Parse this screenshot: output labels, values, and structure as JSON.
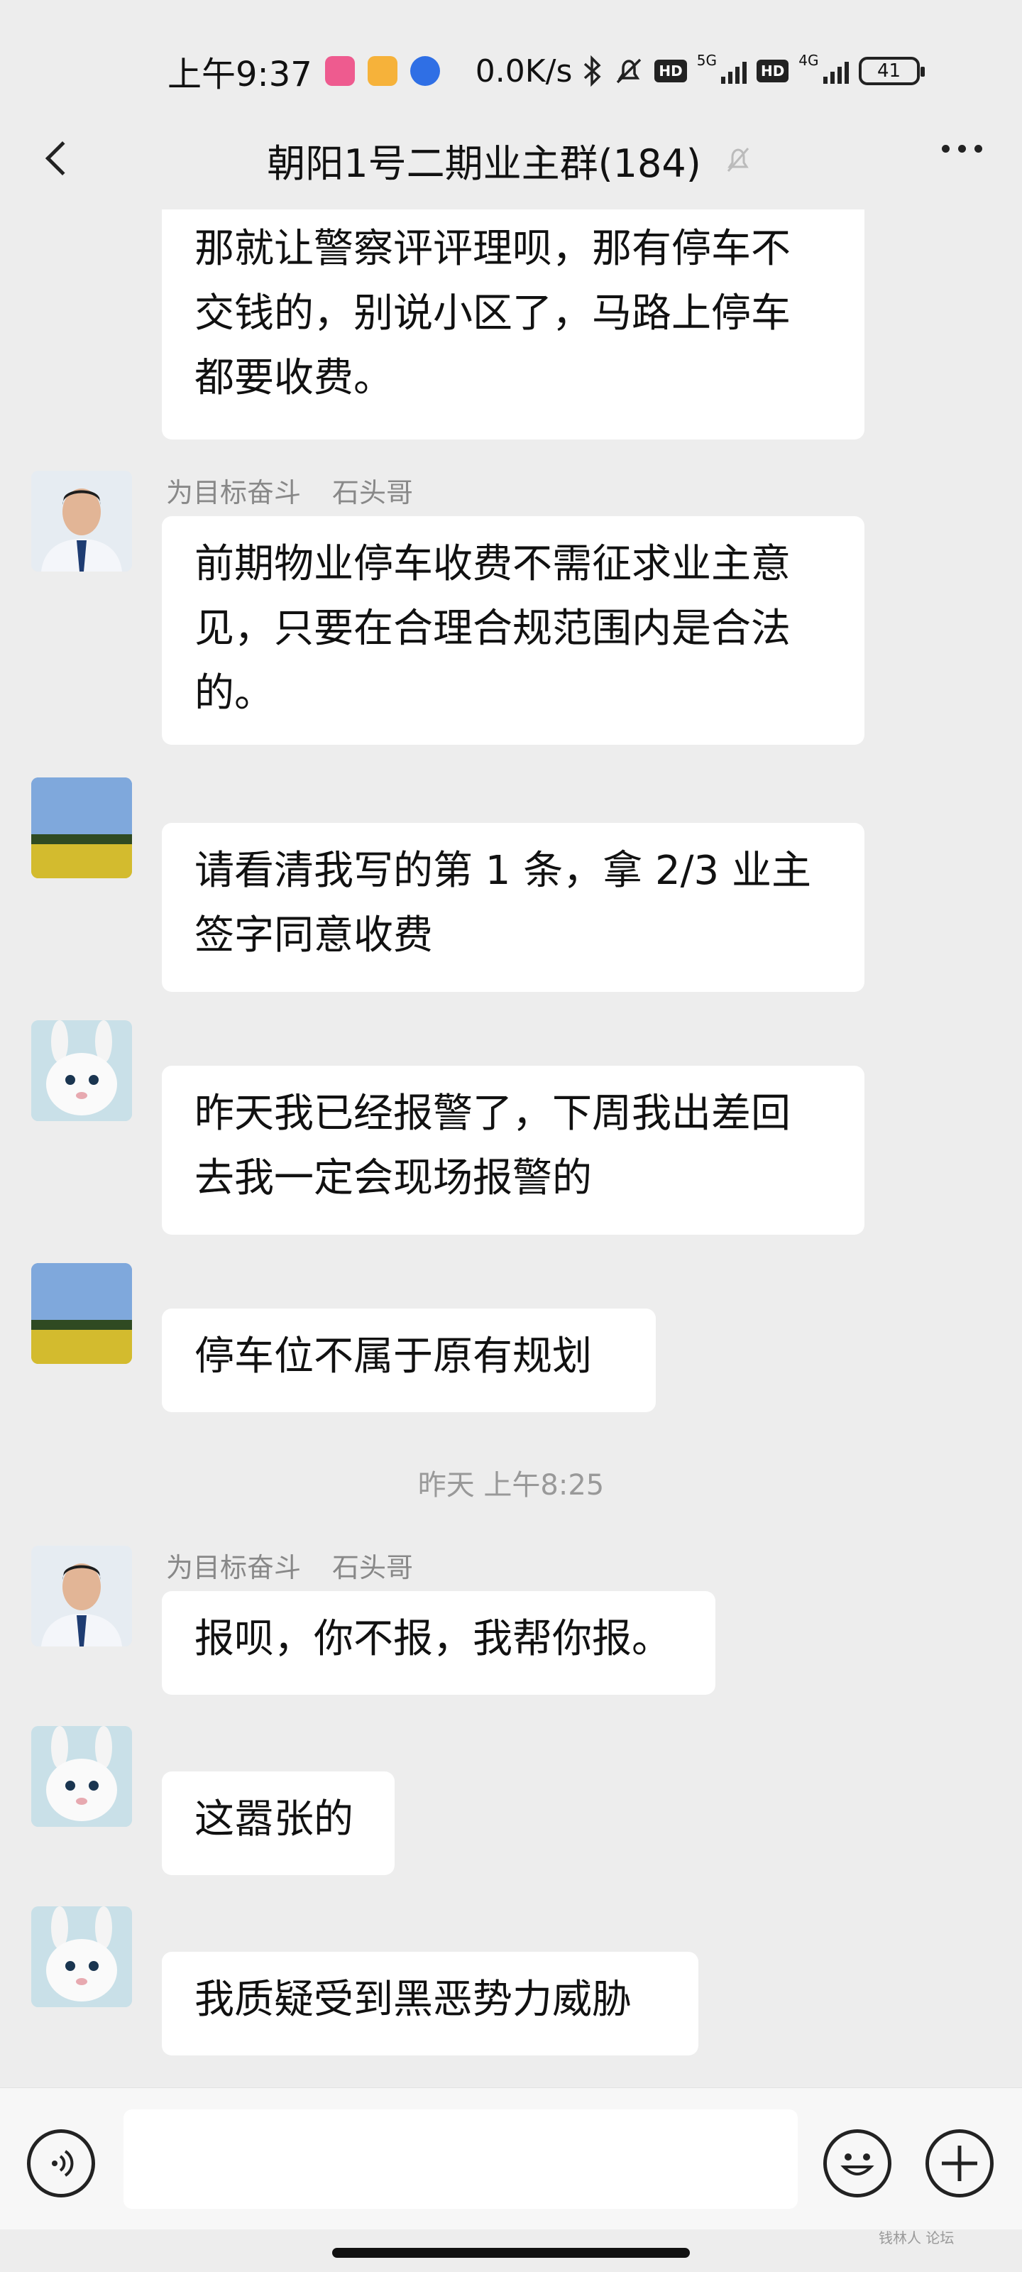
{
  "status_bar": {
    "time": "上午9:37",
    "net_speed": "0.0K/s",
    "hd1": "HD",
    "net1": "5G",
    "hd2": "HD",
    "net2": "4G",
    "battery": "41",
    "app_icon_colors": [
      "#ee5b8f",
      "#f6b23a",
      "#2f6fe5"
    ]
  },
  "header": {
    "title": "朝阳1号二期业主群(184)"
  },
  "messages": [
    {
      "text_lines": [
        "那就让警察评评理呗，那有停车不",
        "交钱的，别说小区了，马路上停车",
        "都要收费。"
      ]
    },
    {
      "sender_group": "为目标奋斗",
      "sender_name": "石头哥",
      "text_lines": [
        "前期物业停车收费不需征求业主意",
        "见，只要在合理合规范围内是合法",
        "的。"
      ]
    },
    {
      "text_lines": [
        "请看清我写的第 1 条，拿 2/3 业主",
        "签字同意收费"
      ]
    },
    {
      "text_lines": [
        "昨天我已经报警了，下周我出差回",
        "去我一定会现场报警的"
      ]
    },
    {
      "text_lines": [
        "停车位不属于原有规划"
      ]
    },
    {
      "sender_group": "为目标奋斗",
      "sender_name": "石头哥",
      "text_lines": [
        "报呗，你不报，我帮你报。"
      ]
    },
    {
      "text_lines": [
        "这嚣张的"
      ]
    },
    {
      "text_lines": [
        "我质疑受到黑恶势力威胁"
      ]
    }
  ],
  "timestamp": "昨天 上午8:25",
  "watermark": "钱林人 论坛"
}
